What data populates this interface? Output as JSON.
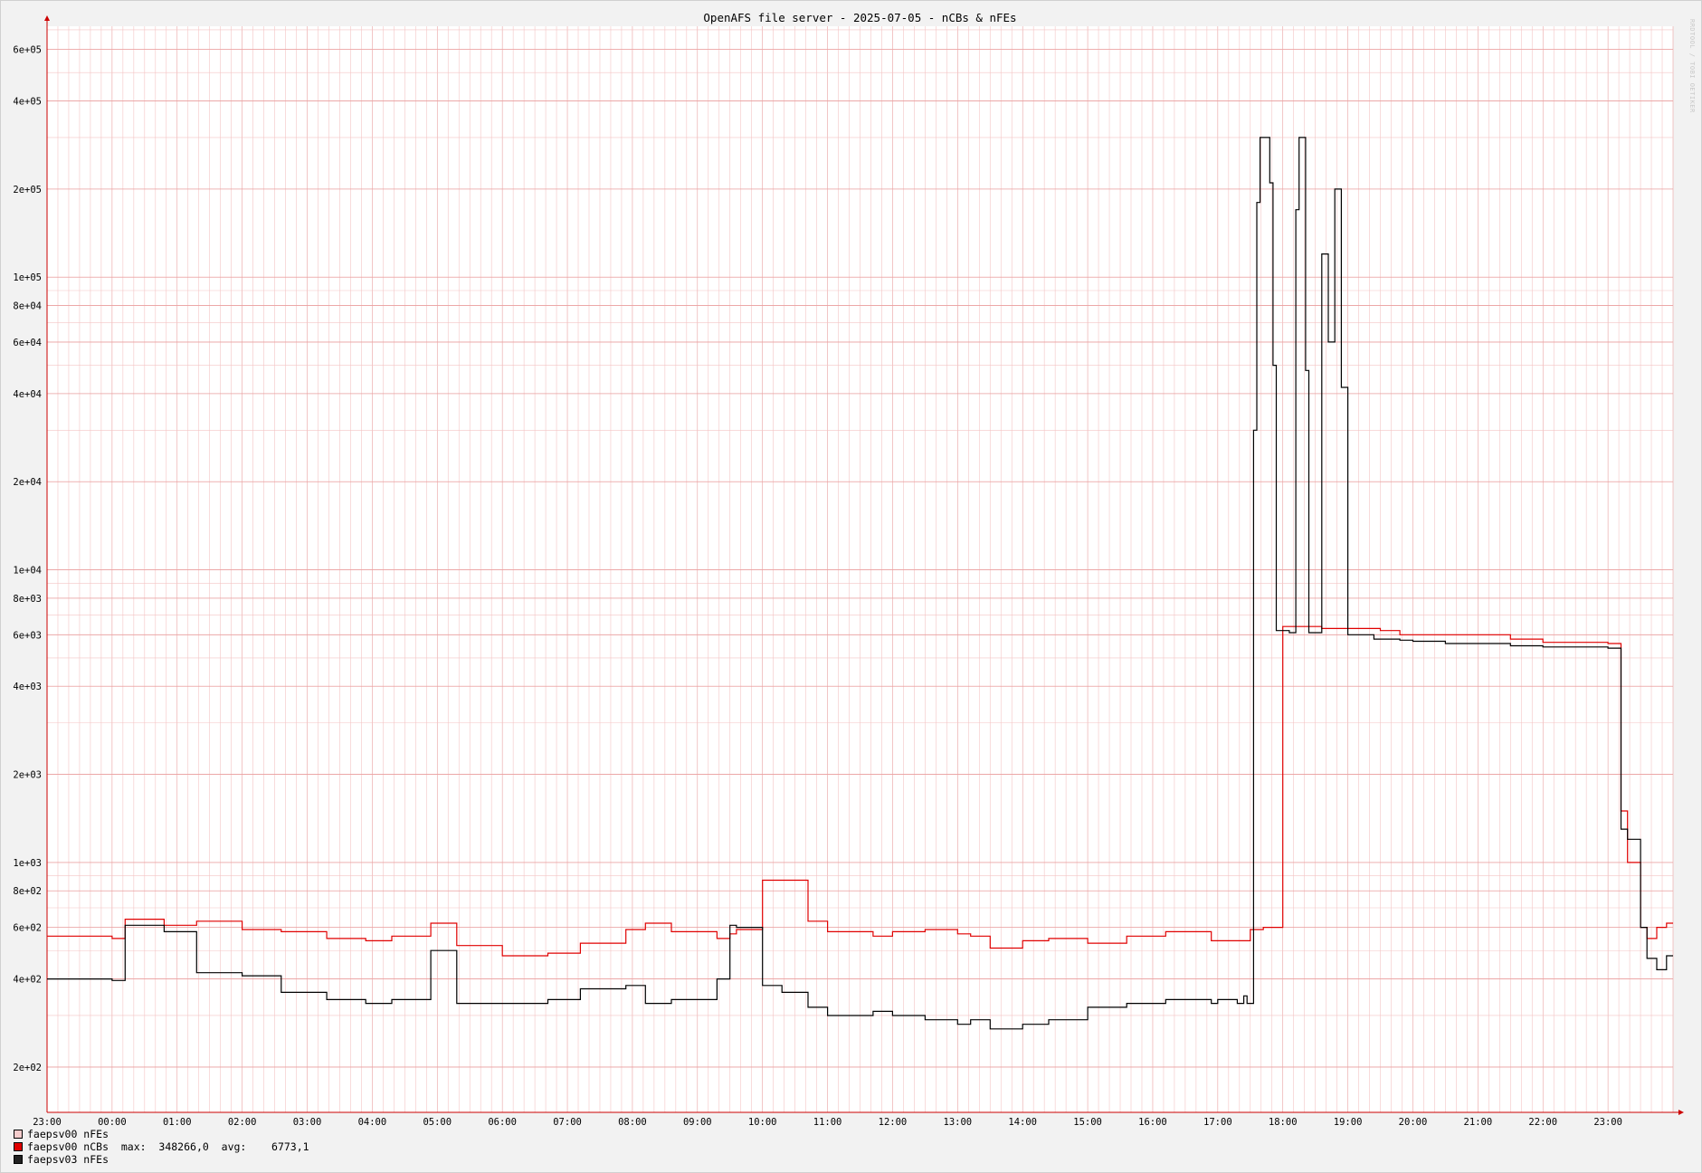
{
  "chart_data": {
    "type": "line",
    "title": "OpenAFS file server - 2025-07-05 - nCBs & nFEs",
    "y_scale": "log",
    "ylim": [
      140,
      720000
    ],
    "y_ticks": [
      "2e+02",
      "4e+02",
      "6e+02",
      "8e+02",
      "1e+03",
      "2e+03",
      "4e+03",
      "6e+03",
      "8e+03",
      "1e+04",
      "2e+04",
      "4e+04",
      "6e+04",
      "8e+04",
      "1e+05",
      "2e+05",
      "4e+05",
      "6e+05"
    ],
    "x_ticks": [
      "23:00",
      "00:00",
      "01:00",
      "02:00",
      "03:00",
      "04:00",
      "05:00",
      "06:00",
      "07:00",
      "08:00",
      "09:00",
      "10:00",
      "11:00",
      "12:00",
      "13:00",
      "14:00",
      "15:00",
      "16:00",
      "17:00",
      "18:00",
      "19:00",
      "20:00",
      "21:00",
      "22:00",
      "23:00"
    ],
    "xlim_hours": [
      0,
      25.0
    ],
    "grid": true,
    "colors": {
      "grid": "#f4c4c4",
      "background": "#ffffff",
      "axis": "#cc0000"
    },
    "series": [
      {
        "name": "faepsv00 nFEs",
        "color": "#f5cccc",
        "x": [
          0
        ],
        "y": [
          560
        ]
      },
      {
        "name": "faepsv00 nCBs",
        "color": "#e00000",
        "x": [
          0,
          1.0,
          1.2,
          1.8,
          2.3,
          3.0,
          3.6,
          4.3,
          4.9,
          5.3,
          5.9,
          6.3,
          7.0,
          7.7,
          8.2,
          8.9,
          9.2,
          9.6,
          10.3,
          10.5,
          10.6,
          11.0,
          11.3,
          11.7,
          12.0,
          12.7,
          13.0,
          13.5,
          14.0,
          14.2,
          14.5,
          15.0,
          15.4,
          16.0,
          16.6,
          17.2,
          17.9,
          18.5,
          18.7,
          19.0,
          19.1,
          19.3,
          19.6,
          20.0,
          20.4,
          20.5,
          20.8,
          21.0,
          21.5,
          22.5,
          23.0,
          24.0,
          24.2,
          24.3,
          24.5,
          24.6,
          24.75,
          24.9,
          25.0
        ],
        "y": [
          560,
          550,
          640,
          610,
          630,
          590,
          580,
          550,
          540,
          560,
          620,
          520,
          480,
          490,
          530,
          590,
          620,
          580,
          550,
          570,
          590,
          870,
          870,
          630,
          580,
          560,
          580,
          590,
          570,
          560,
          510,
          540,
          550,
          530,
          560,
          580,
          540,
          590,
          600,
          6400,
          6400,
          6400,
          6300,
          6300,
          6300,
          6200,
          6000,
          6000,
          6000,
          5800,
          5650,
          5600,
          1500,
          1000,
          600,
          550,
          600,
          620,
          620
        ]
      },
      {
        "name": "faepsv03 nFEs",
        "color": "#000000",
        "x": [
          0,
          1.0,
          1.2,
          1.8,
          2.3,
          3.0,
          3.6,
          4.3,
          4.9,
          5.3,
          5.9,
          6.3,
          7.0,
          7.7,
          8.2,
          8.9,
          9.2,
          9.6,
          10.3,
          10.5,
          10.6,
          11.0,
          11.3,
          11.7,
          12.0,
          12.7,
          13.0,
          13.5,
          14.0,
          14.2,
          14.5,
          15.0,
          15.4,
          16.0,
          16.6,
          17.2,
          17.9,
          18.0,
          18.3,
          18.4,
          18.45,
          18.55,
          18.6,
          18.65,
          18.8,
          18.85,
          18.9,
          19.0,
          19.1,
          19.2,
          19.25,
          19.35,
          19.4,
          19.45,
          19.6,
          19.7,
          19.8,
          19.9,
          20.0,
          20.4,
          20.5,
          20.8,
          21.0,
          21.5,
          22.5,
          23.0,
          24.0,
          24.2,
          24.3,
          24.5,
          24.6,
          24.75,
          24.9,
          25.0
        ],
        "y": [
          400,
          395,
          610,
          580,
          420,
          410,
          360,
          340,
          330,
          340,
          500,
          330,
          330,
          340,
          370,
          380,
          330,
          340,
          400,
          610,
          600,
          380,
          360,
          320,
          300,
          310,
          300,
          290,
          280,
          290,
          270,
          280,
          290,
          320,
          330,
          340,
          330,
          340,
          330,
          350,
          330,
          30000,
          180000,
          300000,
          210000,
          50000,
          6200,
          6200,
          6100,
          170000,
          300000,
          48000,
          6100,
          6100,
          120000,
          60000,
          200000,
          42000,
          6000,
          5800,
          5800,
          5750,
          5700,
          5600,
          5500,
          5450,
          5400,
          1300,
          1200,
          600,
          470,
          430,
          480,
          480
        ]
      }
    ]
  },
  "legend": [
    {
      "label": "faepsv00 nFEs",
      "stats": "",
      "color": "#f5cccc"
    },
    {
      "label": "faepsv00 nCBs",
      "stats": "  max:  348266,0  avg:    6773,1",
      "color": "#e00000"
    },
    {
      "label": "faepsv03 nFEs",
      "stats": "",
      "color": "#222222"
    }
  ],
  "watermark": "RRDTOOL / TOBI OETIKER"
}
